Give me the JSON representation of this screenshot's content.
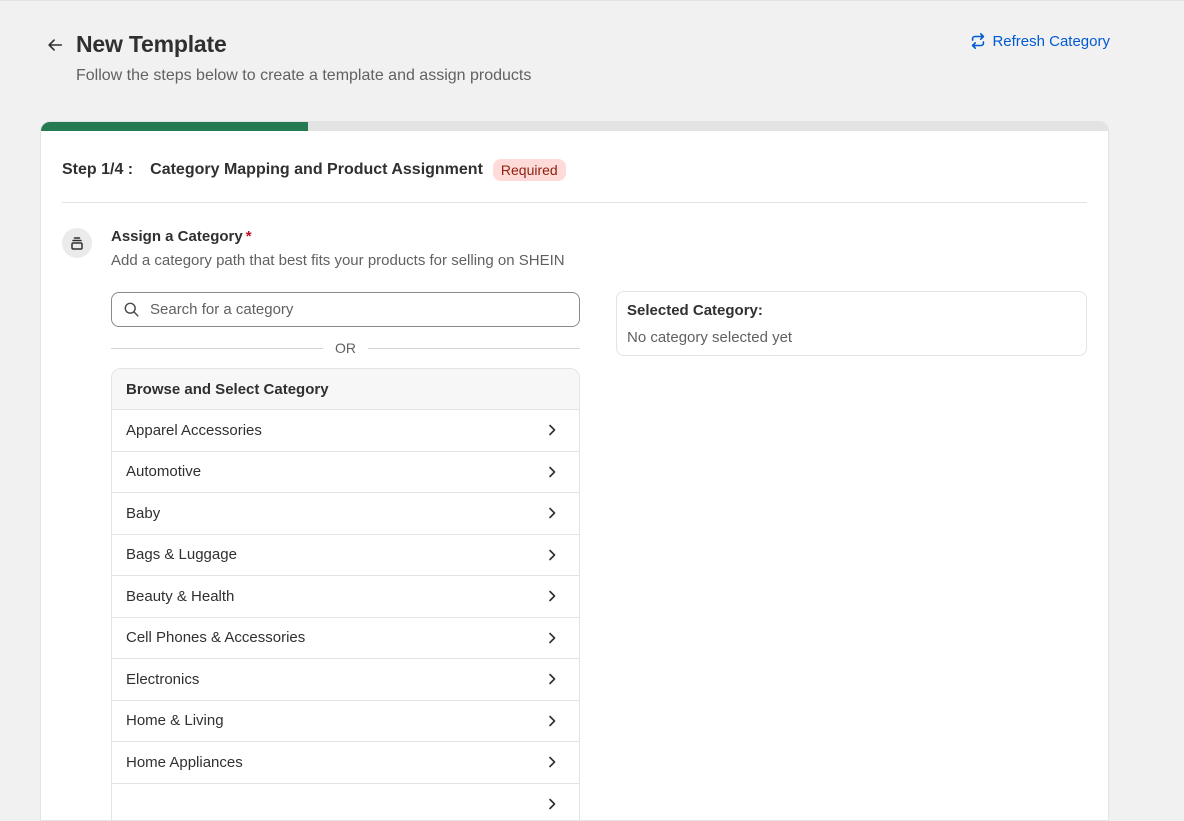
{
  "header": {
    "title": "New Template",
    "subtitle": "Follow the steps below to create a template and assign products",
    "refresh_label": "Refresh Category"
  },
  "progress": {
    "current_step": 1,
    "total_steps": 4,
    "fraction": 0.25
  },
  "step": {
    "label": "Step 1/4 :",
    "title": "Category Mapping and Product Assignment",
    "badge": "Required"
  },
  "assign": {
    "title": "Assign a Category",
    "required_marker": "*",
    "description": "Add a category path that best fits your products for selling on SHEIN"
  },
  "search": {
    "placeholder": "Search for a category",
    "value": ""
  },
  "or_text": "OR",
  "browse": {
    "header": "Browse and Select Category",
    "categories": [
      "Apparel Accessories",
      "Automotive",
      "Baby",
      "Bags & Luggage",
      "Beauty & Health",
      "Cell Phones & Accessories",
      "Electronics",
      "Home & Living",
      "Home Appliances",
      ""
    ]
  },
  "selected": {
    "label": "Selected Category:",
    "value": "No category selected yet"
  },
  "colors": {
    "accent": "#257a52",
    "link": "#005bd3",
    "badge_bg": "#fedad9",
    "badge_text": "#8e1f0b",
    "required": "#c70a24"
  },
  "icons": {
    "back": "arrow-left-icon",
    "refresh": "refresh-icon",
    "assign": "category-stack-icon",
    "search": "search-icon",
    "row": "chevron-right-icon"
  }
}
